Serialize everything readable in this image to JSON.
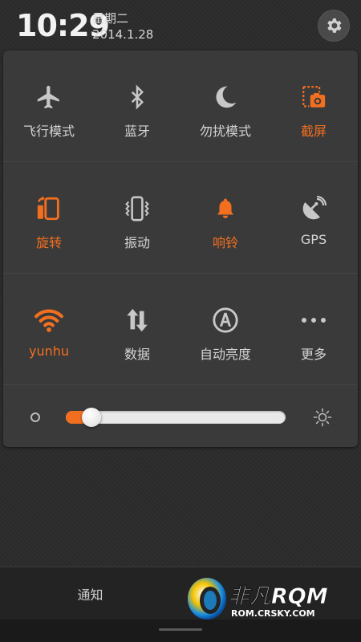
{
  "status": {
    "time": "10:29",
    "weekday": "星期二",
    "date": "2014.1.28"
  },
  "toggles": [
    {
      "label": "飞行模式",
      "icon": "airplane-icon",
      "on": false
    },
    {
      "label": "蓝牙",
      "icon": "bluetooth-icon",
      "on": false
    },
    {
      "label": "勿扰模式",
      "icon": "moon-icon",
      "on": false
    },
    {
      "label": "截屏",
      "icon": "screenshot-icon",
      "on": true
    },
    {
      "label": "旋转",
      "icon": "rotate-icon",
      "on": true
    },
    {
      "label": "振动",
      "icon": "vibrate-icon",
      "on": false
    },
    {
      "label": "响铃",
      "icon": "bell-icon",
      "on": true
    },
    {
      "label": "GPS",
      "icon": "gps-icon",
      "on": false
    },
    {
      "label": "yunhu",
      "icon": "wifi-icon",
      "on": true
    },
    {
      "label": "数据",
      "icon": "data-icon",
      "on": false
    },
    {
      "label": "自动亮度",
      "icon": "auto-brightness-icon",
      "on": false
    },
    {
      "label": "更多",
      "icon": "more-icon",
      "on": false
    }
  ],
  "brightness": {
    "level": 0.08
  },
  "tabs": {
    "notify": "通知"
  },
  "watermark": {
    "brand": "非凡RQM",
    "url": "ROM.CRSKY.COM"
  },
  "colors": {
    "accent": "#f36f20",
    "icon": "#c8c8c8"
  }
}
